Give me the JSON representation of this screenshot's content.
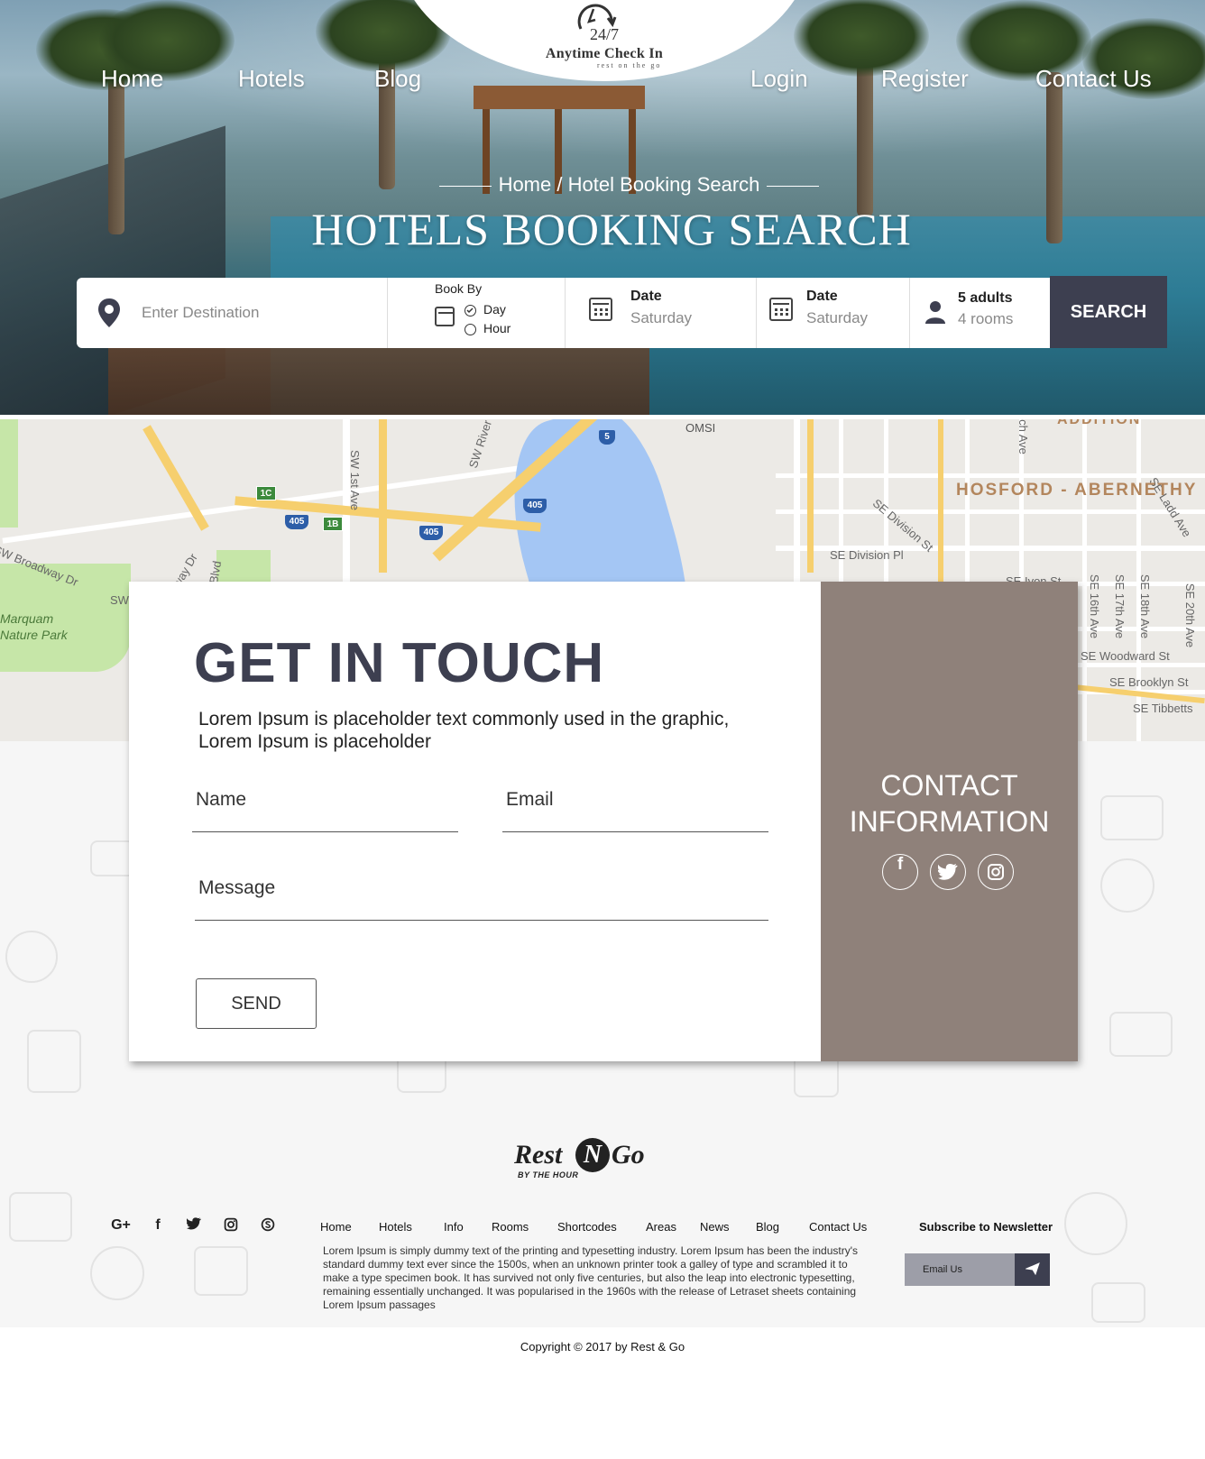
{
  "logo": {
    "clock_text": "24/7",
    "brand": "Anytime Check In",
    "tagline": "rest on the go"
  },
  "nav": {
    "home": "Home",
    "hotels": "Hotels",
    "blog": "Blog",
    "login": "Login",
    "register": "Register",
    "contact": "Contact Us"
  },
  "hero": {
    "breadcrumb_home": "Home",
    "breadcrumb_sep": "/",
    "breadcrumb_current": "Hotel Booking Search",
    "title": "HOTELS BOOKING SEARCH"
  },
  "search": {
    "destination_placeholder": "Enter Destination",
    "book_by_label": "Book By",
    "book_by_options": [
      "Day",
      "Hour"
    ],
    "checkin_label": "Date",
    "checkin_value": "Saturday",
    "checkout_label": "Date",
    "checkout_value": "Saturday",
    "guests": "5 adults",
    "rooms": "4 rooms",
    "button": "SEARCH"
  },
  "map": {
    "labels": [
      "OMSI",
      "SW River",
      "SW 1st Ave",
      "SW Broadway Dr",
      "Marquam",
      "Nature Park",
      "SE Division St",
      "SE Division Pl",
      "SE 16th Ave",
      "SE 17th Ave",
      "SE 18th Ave",
      "SE 20th Ave",
      "SE Woodward St",
      "SE Brooklyn St",
      "SE Tibbetts",
      "SE Ivon St",
      "SE Ladd Ave",
      "ch Ave",
      "way Dr",
      "Blvd",
      "SW"
    ],
    "neighborhood": "HOSFORD - ABERNETHY",
    "top_label": "ADDITION",
    "shields": [
      "405",
      "405",
      "405",
      "5"
    ],
    "exits": [
      "1C",
      "1B"
    ]
  },
  "contact": {
    "title": "GET IN TOUCH",
    "intro": "Lorem Ipsum is placeholder text commonly used in the graphic, Lorem Ipsum is placeholder",
    "name_placeholder": "Name",
    "email_placeholder": "Email",
    "message_placeholder": "Message",
    "send": "SEND",
    "info_title_1": "CONTACT",
    "info_title_2": "INFORMATION",
    "social_icons": [
      "facebook-icon",
      "twitter-icon",
      "instagram-icon"
    ]
  },
  "footer": {
    "logo_part1": "Rest",
    "logo_n": "N",
    "logo_part2": "Go",
    "logo_sub": "BY THE HOUR",
    "social_icons": [
      "google-plus-icon",
      "facebook-icon",
      "twitter-icon",
      "instagram-icon",
      "skype-icon"
    ],
    "links": [
      "Home",
      "Hotels",
      "Info",
      "Rooms",
      "Shortcodes",
      "Areas",
      "News",
      "Blog",
      "Contact Us"
    ],
    "text": "Lorem Ipsum is simply dummy text of the printing and typesetting industry. Lorem Ipsum has been the industry's standard dummy text ever since the 1500s, when an unknown printer took a galley of type and scrambled it to make a type specimen book. It has survived not only five centuries, but also the leap into electronic typesetting, remaining essentially unchanged. It was popularised in the 1960s with the release of Letraset sheets containing Lorem Ipsum passages",
    "newsletter_title": "Subscribe to Newsletter",
    "newsletter_placeholder": "Email Us",
    "copyright": "Copyright © 2017 by Rest & Go"
  },
  "colors": {
    "dark": "#3d3f50",
    "taupe": "#8f817a",
    "white": "#ffffff"
  }
}
